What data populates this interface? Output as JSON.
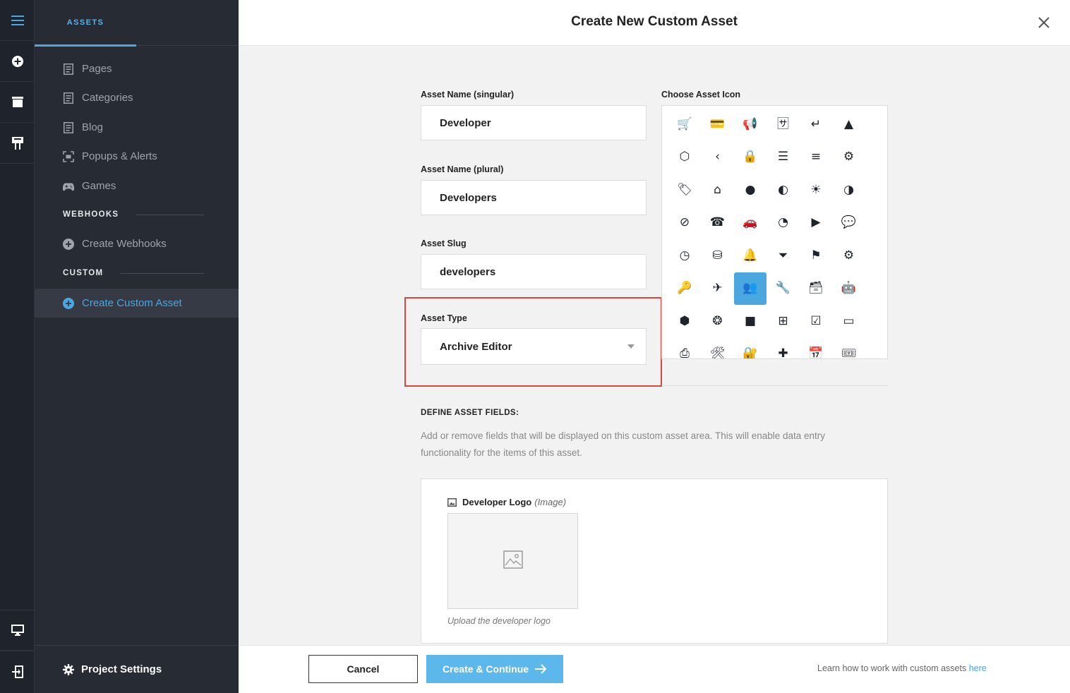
{
  "rail": {
    "items": [
      "menu-icon",
      "add-circle-icon",
      "window-icon",
      "sign-icon",
      "desktop-icon",
      "exit-icon"
    ]
  },
  "sidebar": {
    "tab_label": "ASSETS",
    "items": [
      {
        "label": "Pages",
        "icon": "document-icon"
      },
      {
        "label": "Categories",
        "icon": "document-icon"
      },
      {
        "label": "Blog",
        "icon": "document-icon"
      },
      {
        "label": "Popups & Alerts",
        "icon": "popup-icon"
      },
      {
        "label": "Games",
        "icon": "gamepad-icon"
      }
    ],
    "webhooks_heading": "WEBHOOKS",
    "webhooks_item": "Create Webhooks",
    "custom_heading": "CUSTOM",
    "custom_item": "Create Custom Asset",
    "project_settings": "Project Settings"
  },
  "modal": {
    "title": "Create New Custom Asset",
    "singular_label": "Asset Name (singular)",
    "singular_value": "Developer",
    "plural_label": "Asset Name (plural)",
    "plural_value": "Developers",
    "slug_label": "Asset Slug",
    "slug_value": "developers",
    "type_label": "Asset Type",
    "type_value": "Archive Editor",
    "icon_label": "Choose Asset Icon",
    "icon_grid": [
      [
        "cart",
        "credit-card",
        "megaphone",
        "translate",
        "return-arrow",
        "warning"
      ],
      [
        "html5",
        "chevron-left",
        "lock",
        "tree",
        "list",
        "file-settings"
      ],
      [
        "tag",
        "home",
        "circles",
        "contrast",
        "sun",
        "half-circle"
      ],
      [
        "block",
        "phone",
        "car",
        "pie-chart",
        "play-circle",
        "chat"
      ],
      [
        "gauge",
        "database",
        "bell",
        "filter",
        "flag",
        "gear"
      ],
      [
        "key",
        "paper-plane",
        "users",
        "wrench",
        "archive",
        "android"
      ],
      [
        "cube",
        "aperture",
        "apple",
        "apps",
        "check-box",
        "inbox"
      ],
      [
        "printer",
        "tools",
        "lock-box",
        "medical-box",
        "calendar",
        "ticket"
      ]
    ],
    "selected_icon": "users",
    "define_heading": "DEFINE ASSET FIELDS:",
    "define_description": "Add or remove fields that will be displayed on this custom asset area. This will enable data entry functionality for the items of this asset.",
    "field": {
      "name": "Developer Logo",
      "type": "(Image)",
      "hint": "Upload the developer logo"
    }
  },
  "footer": {
    "cancel": "Cancel",
    "create": "Create & Continue",
    "learn_prefix": "Learn how to work with custom assets",
    "learn_link": "here"
  },
  "colors": {
    "accent": "#4aa7e0",
    "sidebar_bg": "#272b34",
    "highlight": "#d9473c"
  }
}
